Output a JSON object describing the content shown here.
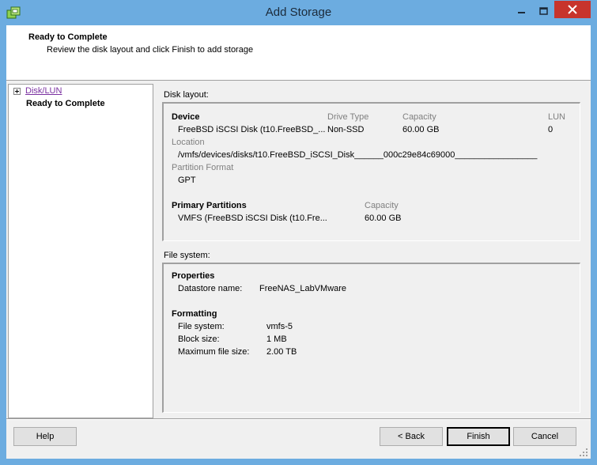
{
  "window": {
    "title": "Add Storage",
    "icon": "datastore-add-icon",
    "controls": [
      "minimize-icon",
      "maximize-icon",
      "close-icon"
    ]
  },
  "header": {
    "title": "Ready to Complete",
    "subtitle": "Review the disk layout and click Finish to add storage"
  },
  "nav": {
    "items": [
      {
        "label": "Disk/LUN",
        "type": "link",
        "expandable": true
      },
      {
        "label": "Ready to Complete",
        "type": "current"
      }
    ]
  },
  "disk_layout": {
    "label": "Disk layout:",
    "device_header": "Device",
    "drive_type_header": "Drive Type",
    "capacity_header": "Capacity",
    "lun_header": "LUN",
    "device": "FreeBSD iSCSI Disk (t10.FreeBSD_...",
    "drive_type": "Non-SSD",
    "capacity": "60.00 GB",
    "lun": "0",
    "location_label": "Location",
    "location": "/vmfs/devices/disks/t10.FreeBSD_iSCSI_Disk______000c29e84c69000_________________",
    "partition_format_label": "Partition Format",
    "partition_format": "GPT",
    "primary_partitions_header": "Primary Partitions",
    "partition_capacity_header": "Capacity",
    "partition": "VMFS (FreeBSD iSCSI Disk (t10.Fre...",
    "partition_capacity": "60.00 GB"
  },
  "file_system": {
    "label": "File system:",
    "properties_header": "Properties",
    "datastore_name_label": "Datastore name:",
    "datastore_name": "FreeNAS_LabVMware",
    "formatting_header": "Formatting",
    "fs_label": "File system:",
    "fs": "vmfs-5",
    "block_size_label": "Block size:",
    "block_size": "1 MB",
    "max_file_size_label": "Maximum file size:",
    "max_file_size": "2.00 TB"
  },
  "buttons": {
    "help": "Help",
    "back": "< Back",
    "finish": "Finish",
    "cancel": "Cancel"
  },
  "colors": {
    "titlebar": "#6cace0",
    "close_button": "#c7342c",
    "dialog_bg": "#f0f0f0",
    "link": "#7a30a0"
  }
}
